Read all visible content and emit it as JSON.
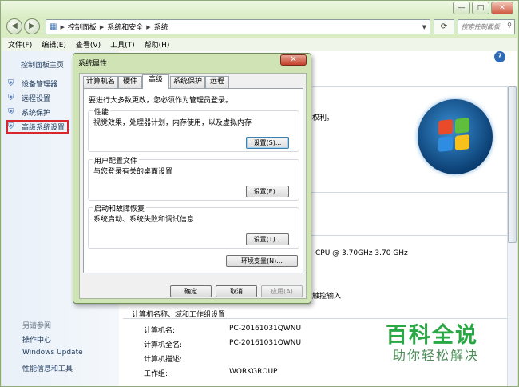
{
  "window": {
    "address": [
      "控制面板",
      "系统和安全",
      "系统"
    ],
    "search_placeholder": "搜索控制面板",
    "caption": {
      "minimize": "—",
      "maximize": "□",
      "close": "✕"
    },
    "nav": {
      "back": "◀",
      "forward": "▶"
    }
  },
  "menu": [
    "文件(F)",
    "编辑(E)",
    "查看(V)",
    "工具(T)",
    "帮助(H)"
  ],
  "sidebar": {
    "home": "控制面板主页",
    "items": [
      {
        "label": "设备管理器"
      },
      {
        "label": "远程设置"
      },
      {
        "label": "系统保护"
      },
      {
        "label": "高级系统设置"
      }
    ],
    "see_also": {
      "heading": "另请参阅",
      "links": [
        "操作中心",
        "Windows Update",
        "性能信息和工具"
      ]
    }
  },
  "main": {
    "partial_text1": "权利。",
    "cpu": "CPU @ 3.70GHz   3.70 GHz",
    "touch": "触控输入",
    "section_title": "计算机名称、域和工作组设置",
    "rows": [
      {
        "label": "计算机名:",
        "value": "PC-20161031QWNU"
      },
      {
        "label": "计算机全名:",
        "value": "PC-20161031QWNU"
      },
      {
        "label": "计算机描述:",
        "value": ""
      },
      {
        "label": "工作组:",
        "value": "WORKGROUP"
      }
    ]
  },
  "dialog": {
    "title": "系统属性",
    "tabs": [
      "计算机名",
      "硬件",
      "高级",
      "系统保护",
      "远程"
    ],
    "selected_tab": "高级",
    "admin_note": "要进行大多数更改，您必须作为管理员登录。",
    "groups": [
      {
        "title": "性能",
        "desc": "视觉效果，处理器计划，内存使用，以及虚拟内存",
        "button": "设置(S)..."
      },
      {
        "title": "用户配置文件",
        "desc": "与您登录有关的桌面设置",
        "button": "设置(E)..."
      },
      {
        "title": "启动和故障恢复",
        "desc": "系统启动、系统失败和调试信息",
        "button": "设置(T)..."
      }
    ],
    "env_button": "环境变量(N)...",
    "ok": "确定",
    "cancel": "取消",
    "apply": "应用(A)"
  },
  "watermark": {
    "line1": "百科全说",
    "line2": "助你轻松解决"
  },
  "colors": {
    "accent_green": "#2aa845",
    "highlight_red": "#d8262c"
  }
}
